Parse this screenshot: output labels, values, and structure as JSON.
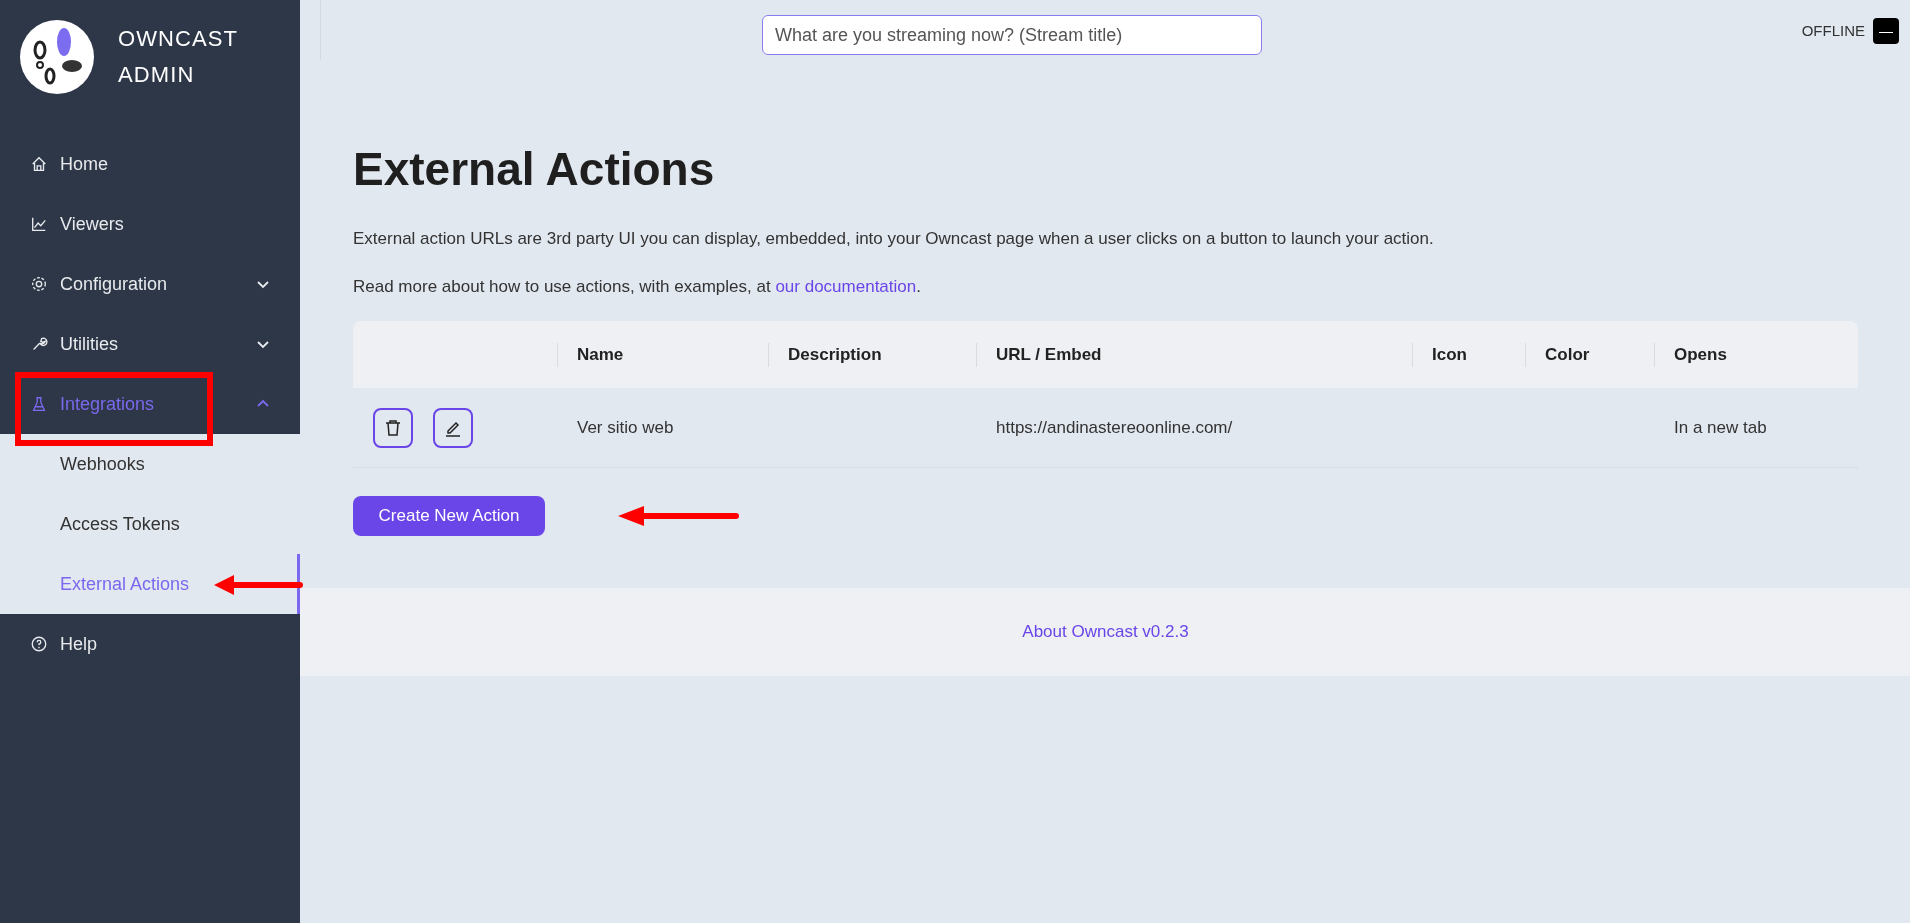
{
  "sidebar": {
    "brand": [
      "OWNCAST",
      "ADMIN"
    ],
    "items": [
      {
        "label": "Home",
        "selected": false
      },
      {
        "label": "Viewers",
        "selected": false
      },
      {
        "label": "Configuration",
        "expanded": false,
        "selected": false
      },
      {
        "label": "Utilities",
        "expanded": false,
        "selected": false
      },
      {
        "label": "Integrations",
        "expanded": true,
        "selected": true,
        "children": [
          {
            "label": "Webhooks",
            "selected": false
          },
          {
            "label": "Access Tokens",
            "selected": false
          },
          {
            "label": "External Actions",
            "selected": true
          }
        ]
      },
      {
        "label": "Help",
        "selected": false
      }
    ]
  },
  "header": {
    "stream_title": {
      "placeholder": "What are you streaming now? (Stream title)"
    },
    "status": "OFFLINE",
    "status_button": "—"
  },
  "page": {
    "title": "External Actions",
    "intro": "External action URLs are 3rd party UI you can display, embedded, into your Owncast page when a user clicks on a button to launch your action.",
    "more_text": "Read more about how to use actions, with examples, at ",
    "more_link": "our documentation",
    "more_end": ".",
    "table": {
      "columns": [
        "",
        "Name",
        "Description",
        "URL / Embed",
        "Icon",
        "Color",
        "Opens"
      ],
      "rows": [
        {
          "cells": [
            "",
            "Ver sitio web",
            "",
            "https://andinastereoonline.com/",
            "",
            "",
            "In a new tab"
          ]
        }
      ]
    },
    "create_button": "Create New Action"
  },
  "footer": {
    "link": "About Owncast v0.2.3"
  }
}
